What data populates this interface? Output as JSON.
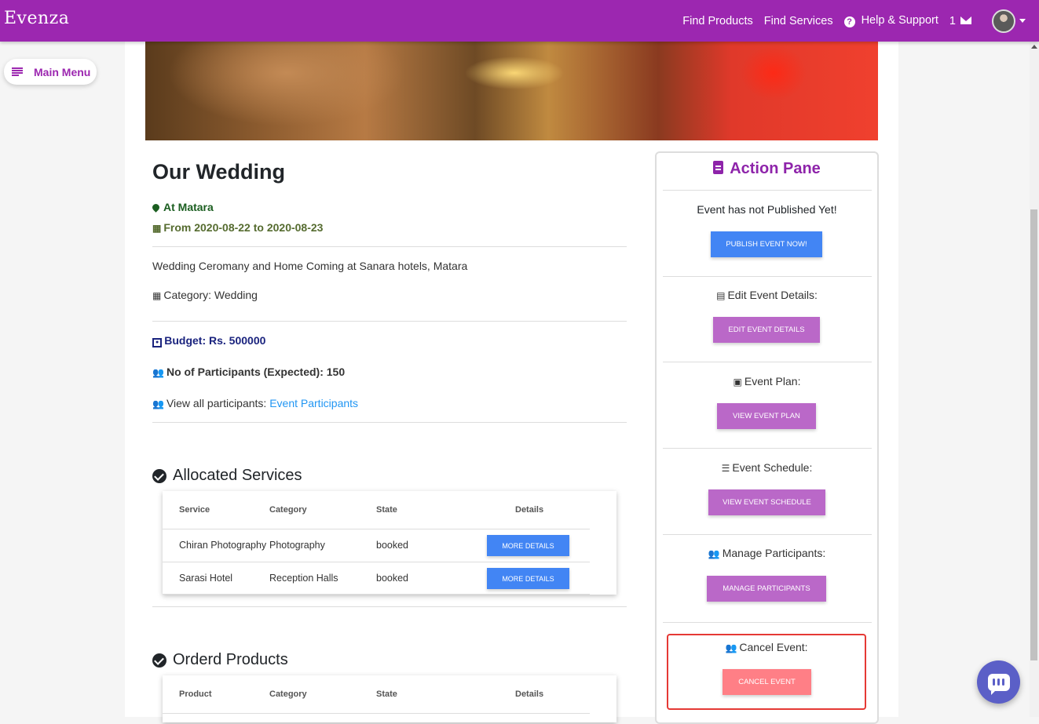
{
  "app": {
    "brand": "Evenza"
  },
  "nav": {
    "find_products": "Find Products",
    "find_services": "Find Services",
    "help": "Help & Support",
    "msg_count": "1"
  },
  "sidebar": {
    "main_menu": "Main Menu"
  },
  "event": {
    "title": "Our Wedding",
    "location": "At Matara",
    "dates": "From 2020-08-22 to 2020-08-23",
    "description": "Wedding Ceromany and Home Coming at Sanara hotels, Matara",
    "category": "Category: Wedding",
    "budget": "Budget: Rs. 500000",
    "participants": "No of Participants (Expected): 150",
    "view_all_prefix": "View all participants: ",
    "view_all_link": "Event Participants"
  },
  "allocated_services": {
    "title": "Allocated Services",
    "headers": [
      "Service",
      "Category",
      "State",
      "Details"
    ],
    "rows": [
      {
        "service": "Chiran Photography",
        "category": "Photography",
        "state": "booked",
        "button": "More Details"
      },
      {
        "service": "Sarasi Hotel",
        "category": "Reception Halls",
        "state": "booked",
        "button": "More Details"
      }
    ]
  },
  "ordered_products": {
    "title": "Orderd Products",
    "headers": [
      "Product",
      "Category",
      "State",
      "Details"
    ]
  },
  "action_pane": {
    "title": "Action Pane",
    "status": "Event has not Published Yet!",
    "publish_btn": "Publish Event Now!",
    "edit_label": "Edit Event Details:",
    "edit_btn": "Edit Event Details",
    "plan_label": "Event Plan:",
    "plan_btn": "View Event Plan",
    "schedule_label": "Event Schedule:",
    "schedule_btn": "View Event Schedule",
    "manage_label": "Manage Participants:",
    "manage_btn": "Manage Participants",
    "cancel_label": "Cancel Event:",
    "cancel_btn": "Cancel Event"
  },
  "colors": {
    "brand": "#9c27b0",
    "blue_button": "#4285f4",
    "purple_button": "#ba68c8",
    "cancel_button": "#ff7f86",
    "cancel_border": "#e53935"
  }
}
